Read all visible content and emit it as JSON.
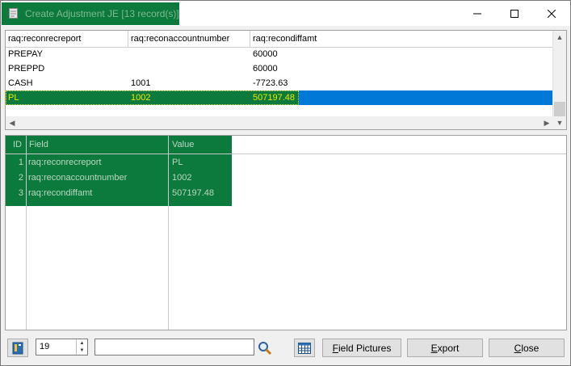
{
  "window": {
    "title": "Create Adjustment JE [13 record(s)]"
  },
  "top_grid": {
    "columns": [
      "raq:reconrecreport",
      "raq:reconaccountnumber",
      "raq:recondiffamt"
    ],
    "rows": [
      [
        "PREPAY",
        "",
        "60000"
      ],
      [
        "PREPPD",
        "",
        "60000"
      ],
      [
        "CASH",
        "1001",
        "-7723.63"
      ],
      [
        "PL",
        "1002",
        "507197.48"
      ]
    ]
  },
  "detail_grid": {
    "columns": [
      "ID",
      "Field",
      "Value"
    ],
    "rows": [
      [
        "1",
        "raq:reconrecreport",
        "PL"
      ],
      [
        "2",
        "raq:reconaccountnumber",
        "1002"
      ],
      [
        "3",
        "raq:recondiffamt",
        "507197.48"
      ]
    ]
  },
  "toolbar": {
    "spinner_value": "19",
    "search_value": "",
    "field_pictures_label": "Field Pictures",
    "field_pictures_underline": "F",
    "export_label": "Export",
    "export_underline": "E",
    "close_label": "Close",
    "close_underline": "C"
  },
  "colors": {
    "highlight_green": "#0c7a3c",
    "selection_blue": "#0078d7",
    "selected_text": "#e8e800"
  },
  "icons": [
    "document-icon",
    "minimize-icon",
    "maximize-icon",
    "close-icon",
    "bookmark-icon",
    "search-icon",
    "calendar-grid-icon"
  ]
}
